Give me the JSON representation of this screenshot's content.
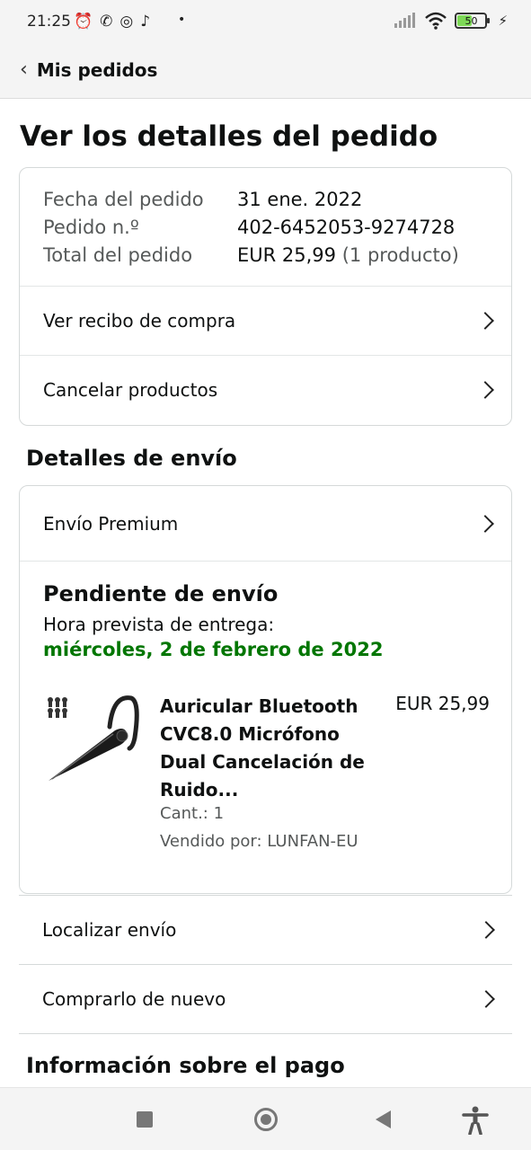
{
  "status_bar": {
    "time": "21:25",
    "left_icons": [
      "alarm-icon",
      "whatsapp-icon",
      "instagram-icon",
      "tiktok-icon"
    ],
    "battery_level": "50"
  },
  "nav": {
    "back_label": "Mis pedidos"
  },
  "page_title": "Ver los detalles del pedido",
  "summary": {
    "date_label": "Fecha del pedido",
    "date_value": "31 ene. 2022",
    "order_label": "Pedido n.º",
    "order_value": "402-6452053-9274728",
    "total_label": "Total del pedido",
    "total_value": "EUR 25,99",
    "total_count": "(1 producto)"
  },
  "order_actions": {
    "receipt_label": "Ver recibo de compra",
    "cancel_label": "Cancelar productos"
  },
  "shipping": {
    "section_title": "Detalles de envío",
    "method_label": "Envío Premium",
    "status_title": "Pendiente de envío",
    "eta_label": "Hora prevista de entrega:",
    "eta_date": "miércoles, 2 de febrero de 2022",
    "accent_color": "#007600",
    "product": {
      "title": "Auricular Bluetooth CVC8.0 Micrófono Dual Cancelación de Ruido...",
      "price": "EUR 25,99",
      "quantity": "Cant.: 1",
      "seller": "Vendido por: LUNFAN-EU"
    }
  },
  "shipment_actions": {
    "track_label": "Localizar envío",
    "buy_again_label": "Comprarlo de nuevo"
  },
  "payment": {
    "section_title": "Información sobre el pago"
  }
}
